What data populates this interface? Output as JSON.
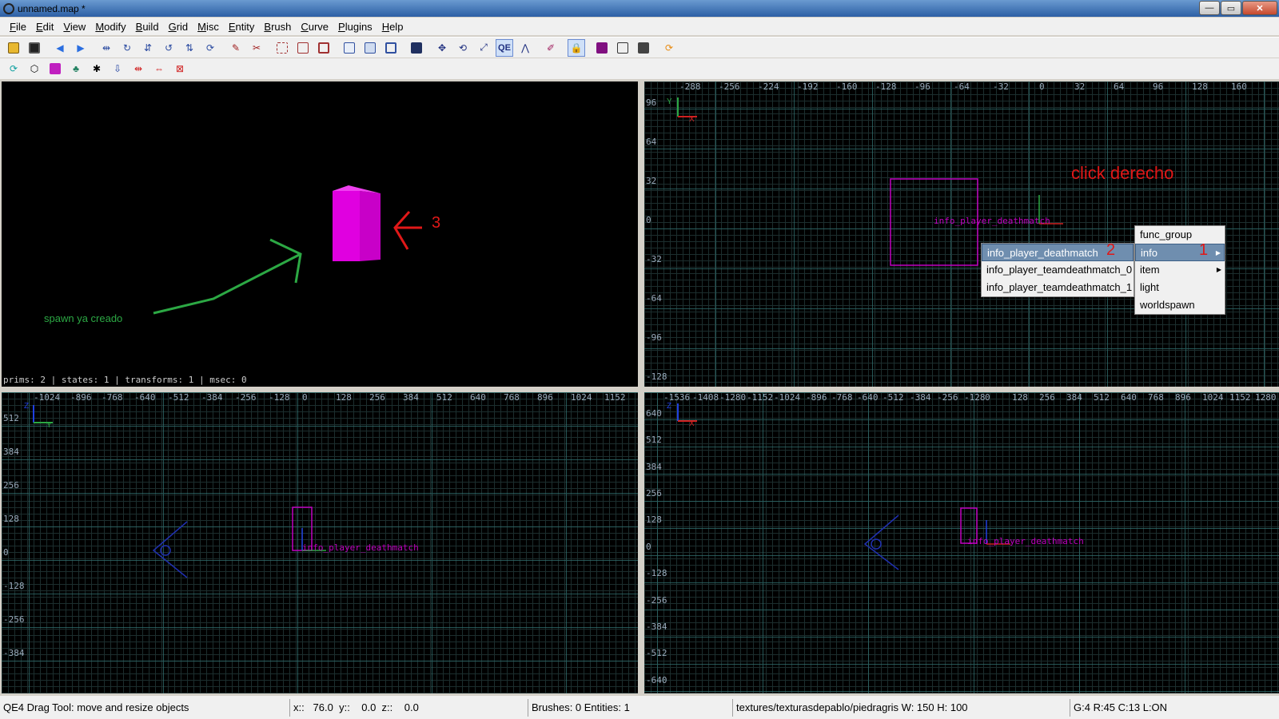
{
  "window": {
    "title": "unnamed.map *",
    "minimize": "—",
    "maximize": "▭",
    "close": "✕"
  },
  "menu": [
    {
      "label": "File",
      "key": "F",
      "rest": "ile"
    },
    {
      "label": "Edit",
      "key": "E",
      "rest": "dit"
    },
    {
      "label": "View",
      "key": "V",
      "rest": "iew"
    },
    {
      "label": "Modify",
      "key": "M",
      "rest": "odify"
    },
    {
      "label": "Build",
      "key": "B",
      "rest": "uild"
    },
    {
      "label": "Grid",
      "key": "G",
      "rest": "rid"
    },
    {
      "label": "Misc",
      "key": "M",
      "rest": "isc"
    },
    {
      "label": "Entity",
      "key": "E",
      "rest": "ntity"
    },
    {
      "label": "Brush",
      "key": "B",
      "rest": "rush"
    },
    {
      "label": "Curve",
      "key": "C",
      "rest": "urve"
    },
    {
      "label": "Plugins",
      "key": "P",
      "rest": "lugins"
    },
    {
      "label": "Help",
      "key": "H",
      "rest": "elp"
    }
  ],
  "toolbar1_qe": "QE",
  "viewport3d": {
    "stats": "prims: 2 | states: 1 | transforms: 1 | msec: 0",
    "annotation_spawn": "spawn ya creado",
    "annotation_3": "3",
    "colors": {
      "cube": "#e000e0",
      "green": "#2ca844",
      "red": "#e01818"
    }
  },
  "viewportXY": {
    "ruler_x": [
      "-288",
      "-256",
      "-224",
      "-192",
      "-160",
      "-128",
      "-96",
      "-64",
      "-32",
      "0",
      "32",
      "64",
      "96",
      "128",
      "160"
    ],
    "ruler_y": [
      "96",
      "64",
      "32",
      "0",
      "-32",
      "-64",
      "-96",
      "-128"
    ],
    "entity_label": "info_player_deathmatch",
    "axis_x": "X",
    "axis_y": "Y",
    "annotation_click": "click derecho"
  },
  "viewportYZ": {
    "ruler_x": [
      "-1024",
      "-896",
      "-768",
      "-640",
      "-512",
      "-384",
      "-256",
      "-128",
      "0",
      "128",
      "256",
      "384",
      "512",
      "640",
      "768",
      "896",
      "1024",
      "1152"
    ],
    "ruler_y": [
      "512",
      "384",
      "256",
      "128",
      "0",
      "-128",
      "-256",
      "-384"
    ],
    "entity_label": "info_player_deathmatch",
    "axis_y": "Y",
    "axis_z": "Z"
  },
  "viewportXZ": {
    "ruler_x": [
      "-1536",
      "-1408",
      "-1280",
      "-1152",
      "-1024",
      "-896",
      "-768",
      "-640",
      "-512",
      "-384",
      "-256",
      "-128",
      "0",
      "128",
      "256",
      "384",
      "512",
      "640",
      "768",
      "896",
      "1024",
      "1152",
      "1280"
    ],
    "ruler_y": [
      "640",
      "512",
      "384",
      "256",
      "128",
      "0",
      "-128",
      "-256",
      "-384",
      "-512",
      "-640"
    ],
    "entity_label": "info_player_deathmatch",
    "axis_x": "X",
    "axis_z": "Z"
  },
  "context_menu": {
    "items": [
      {
        "label": "func_group",
        "submenu": false
      },
      {
        "label": "info",
        "submenu": true,
        "highlighted": true
      },
      {
        "label": "item",
        "submenu": true
      },
      {
        "label": "light",
        "submenu": false
      },
      {
        "label": "worldspawn",
        "submenu": false
      }
    ],
    "annotation_1": "1"
  },
  "submenu": {
    "items": [
      {
        "label": "info_player_deathmatch",
        "highlighted": true
      },
      {
        "label": "info_player_teamdeathmatch_0"
      },
      {
        "label": "info_player_teamdeathmatch_1"
      }
    ],
    "annotation_2": "2"
  },
  "status": {
    "tool": "QE4 Drag Tool: move and resize objects",
    "coords": "x::   76.0  y::    0.0  z::    0.0",
    "counts": "Brushes: 0 Entities: 1",
    "texture": "textures/texturasdepablo/piedragris W: 150 H: 100",
    "grid": "G:4  R:45  C:13  L:ON"
  }
}
